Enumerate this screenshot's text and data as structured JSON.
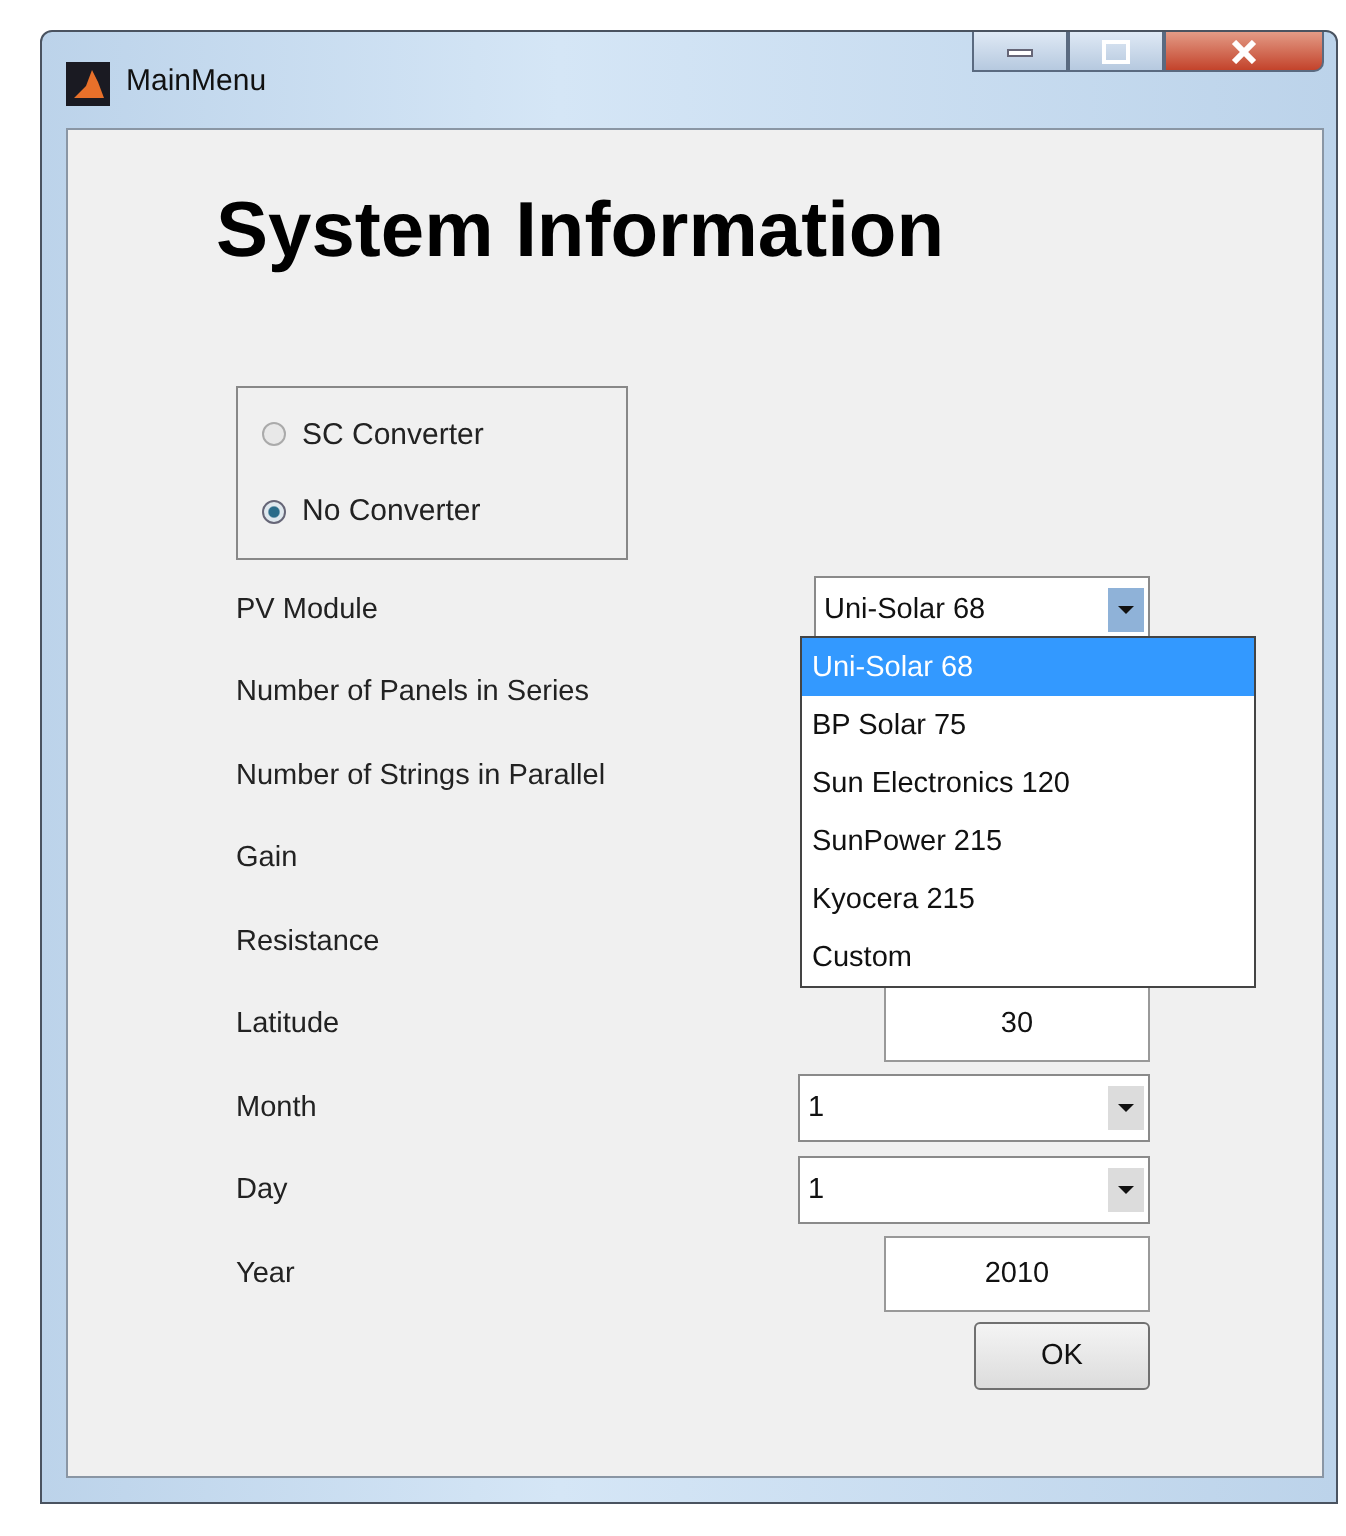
{
  "window": {
    "title": "MainMenu"
  },
  "heading": "System Information",
  "converter": [
    {
      "label": "SC Converter",
      "selected": false
    },
    {
      "label": "No Converter",
      "selected": true
    }
  ],
  "rows": [
    {
      "label": "PV Module",
      "kind": "dropdown",
      "value": "Uni-Solar 68"
    },
    {
      "label": "Number of Panels in Series",
      "kind": "covered"
    },
    {
      "label": "Number of Strings in Parallel",
      "kind": "covered"
    },
    {
      "label": "Gain",
      "kind": "covered"
    },
    {
      "label": "Resistance",
      "kind": "covered"
    },
    {
      "label": "Latitude",
      "kind": "text",
      "value": "30"
    },
    {
      "label": "Month",
      "kind": "wide-dropdown",
      "value": "1"
    },
    {
      "label": "Day",
      "kind": "wide-dropdown",
      "value": "1"
    },
    {
      "label": "Year",
      "kind": "text",
      "value": "2010"
    }
  ],
  "dropdown_list": {
    "items": [
      {
        "label": "Uni-Solar 68",
        "selected": true
      },
      {
        "label": "BP Solar 75",
        "selected": false
      },
      {
        "label": "Sun Electronics 120",
        "selected": false
      },
      {
        "label": "SunPower 215",
        "selected": false
      },
      {
        "label": "Kyocera 215",
        "selected": false
      },
      {
        "label": "Custom",
        "selected": false
      }
    ]
  },
  "ok_button": "OK"
}
